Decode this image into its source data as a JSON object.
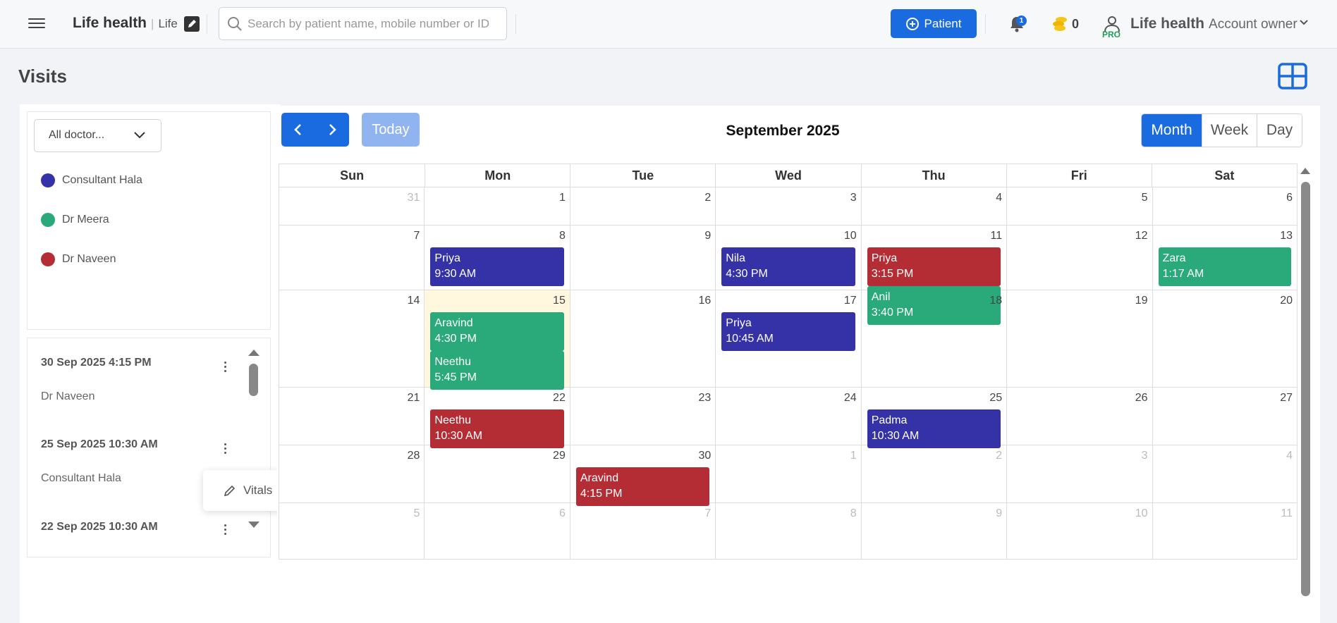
{
  "header": {
    "brand_name": "Life health",
    "brand_separator": "|",
    "brand_sub": "Life",
    "search_placeholder": "Search by patient name, mobile number or ID",
    "search_value": "",
    "patient_button_label": "Patient",
    "notification_count": "1",
    "coin_count": "0",
    "pro_badge": "PRO",
    "account_name": "Life health",
    "account_role": "Account owner"
  },
  "page": {
    "title": "Visits"
  },
  "doctors": {
    "select_label": "All doctor...",
    "items": [
      {
        "name": "Consultant Hala",
        "color": "#3532a8"
      },
      {
        "name": "Dr Meera",
        "color": "#2aa97a"
      },
      {
        "name": "Dr Naveen",
        "color": "#b52d34"
      }
    ]
  },
  "visits": [
    {
      "date": "30 Sep 2025 4:15 PM",
      "doctor": "Dr Naveen"
    },
    {
      "date": "25 Sep 2025 10:30 AM",
      "doctor": "Consultant Hala"
    },
    {
      "date": "22 Sep 2025 10:30 AM",
      "doctor": ""
    }
  ],
  "popover": {
    "vitals_label": "Vitals"
  },
  "calendar": {
    "today_label": "Today",
    "title": "September 2025",
    "views": [
      {
        "label": "Month",
        "active": true
      },
      {
        "label": "Week",
        "active": false
      },
      {
        "label": "Day",
        "active": false
      }
    ],
    "weekdays": [
      "Sun",
      "Mon",
      "Tue",
      "Wed",
      "Thu",
      "Fri",
      "Sat"
    ],
    "weeks": [
      [
        {
          "d": "31",
          "o": true
        },
        {
          "d": "1"
        },
        {
          "d": "2"
        },
        {
          "d": "3"
        },
        {
          "d": "4"
        },
        {
          "d": "5"
        },
        {
          "d": "6"
        }
      ],
      [
        {
          "d": "7"
        },
        {
          "d": "8"
        },
        {
          "d": "9"
        },
        {
          "d": "10"
        },
        {
          "d": "11"
        },
        {
          "d": "12"
        },
        {
          "d": "13"
        }
      ],
      [
        {
          "d": "14"
        },
        {
          "d": "15",
          "today": true
        },
        {
          "d": "16"
        },
        {
          "d": "17"
        },
        {
          "d": "18"
        },
        {
          "d": "19"
        },
        {
          "d": "20"
        }
      ],
      [
        {
          "d": "21"
        },
        {
          "d": "22"
        },
        {
          "d": "23"
        },
        {
          "d": "24"
        },
        {
          "d": "25"
        },
        {
          "d": "26"
        },
        {
          "d": "27"
        }
      ],
      [
        {
          "d": "28"
        },
        {
          "d": "29"
        },
        {
          "d": "30"
        },
        {
          "d": "1",
          "o": true
        },
        {
          "d": "2",
          "o": true
        },
        {
          "d": "3",
          "o": true
        },
        {
          "d": "4",
          "o": true
        }
      ],
      [
        {
          "d": "5",
          "o": true
        },
        {
          "d": "6",
          "o": true
        },
        {
          "d": "7",
          "o": true
        },
        {
          "d": "8",
          "o": true
        },
        {
          "d": "9",
          "o": true
        },
        {
          "d": "10",
          "o": true
        },
        {
          "d": "11",
          "o": true
        }
      ]
    ],
    "events": [
      {
        "week": 1,
        "day": 1,
        "slot": 0,
        "name": "Priya",
        "time": "9:30 AM",
        "doctor": "Consultant Hala"
      },
      {
        "week": 1,
        "day": 3,
        "slot": 0,
        "name": "Nila",
        "time": "4:30 PM",
        "doctor": "Consultant Hala"
      },
      {
        "week": 1,
        "day": 4,
        "slot": 0,
        "name": "Priya",
        "time": "3:15 PM",
        "doctor": "Dr Naveen"
      },
      {
        "week": 1,
        "day": 4,
        "slot": 1,
        "name": "Anil",
        "time": "3:40 PM",
        "doctor": "Dr Meera"
      },
      {
        "week": 1,
        "day": 6,
        "slot": 0,
        "name": "Zara",
        "time": "1:17 AM",
        "doctor": "Dr Meera"
      },
      {
        "week": 2,
        "day": 1,
        "slot": 0,
        "name": "Aravind",
        "time": "4:30 PM",
        "doctor": "Dr Meera"
      },
      {
        "week": 2,
        "day": 1,
        "slot": 1,
        "name": "Neethu",
        "time": "5:45 PM",
        "doctor": "Dr Meera"
      },
      {
        "week": 2,
        "day": 3,
        "slot": 0,
        "name": "Priya",
        "time": "10:45 AM",
        "doctor": "Consultant Hala"
      },
      {
        "week": 3,
        "day": 1,
        "slot": 0,
        "name": "Neethu",
        "time": "10:30 AM",
        "doctor": "Dr Naveen"
      },
      {
        "week": 3,
        "day": 4,
        "slot": 0,
        "name": "Padma",
        "time": "10:30 AM",
        "doctor": "Consultant Hala"
      },
      {
        "week": 4,
        "day": 2,
        "slot": 0,
        "name": "Aravind",
        "time": "4:15 PM",
        "doctor": "Dr Naveen"
      }
    ]
  },
  "colors": {
    "accent": "#1b6be0",
    "today_bg": "#fff8df"
  }
}
